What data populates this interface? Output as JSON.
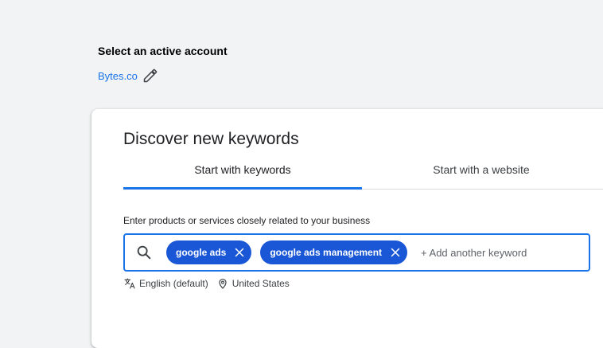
{
  "account": {
    "heading": "Select an active account",
    "name": "Bytes.co"
  },
  "card": {
    "title": "Discover new keywords",
    "tabs": [
      {
        "label": "Start with keywords",
        "active": true
      },
      {
        "label": "Start with a website",
        "active": false
      }
    ],
    "input_label": "Enter products or services closely related to your business",
    "keywords": [
      "google ads",
      "google ads management"
    ],
    "add_placeholder": "+ Add another keyword",
    "add_value": "",
    "language": "English (default)",
    "location": "United States"
  },
  "colors": {
    "accent": "#1a73e8",
    "chip": "#1a57d6",
    "background": "#f1f3f4"
  },
  "icons": {
    "edit": "pencil-icon",
    "search": "search-icon",
    "chip_close": "close-icon",
    "language": "translate-icon",
    "location": "location-pin-icon"
  }
}
